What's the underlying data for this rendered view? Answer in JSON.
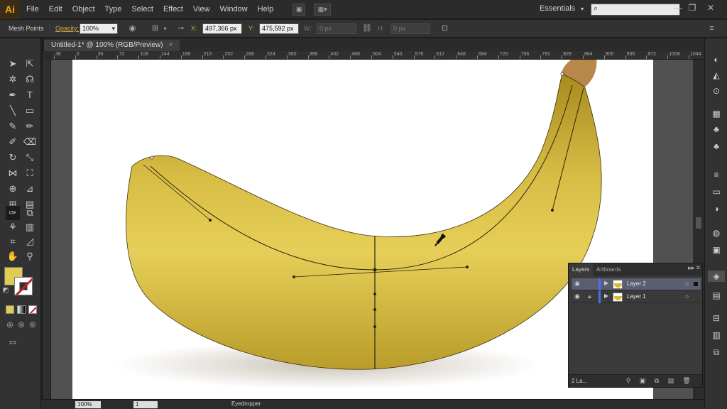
{
  "app": {
    "logo": "Ai"
  },
  "menu": [
    "File",
    "Edit",
    "Object",
    "Type",
    "Select",
    "Effect",
    "View",
    "Window",
    "Help"
  ],
  "workspace": {
    "label": "Essentials",
    "caret": "▾"
  },
  "search": {
    "placeholder": ""
  },
  "window_controls": {
    "minimize": "—",
    "restore": "❐",
    "close": "✕"
  },
  "control_bar": {
    "tool_name": "Mesh Points",
    "opacity_label": "Opacity:",
    "opacity_value": "100%",
    "x_label": "X:",
    "x_value": "497,366 px",
    "y_label": "Y:",
    "y_value": "475,592 px",
    "w_label": "W:",
    "w_value": "0 px",
    "h_label": "H:",
    "h_value": "0 px"
  },
  "document_tab": {
    "title": "Untitled-1* @ 100% (RGB/Preview)",
    "close": "×"
  },
  "ruler_ticks": [
    "36",
    "0",
    "36",
    "72",
    "108",
    "144",
    "180",
    "216",
    "252",
    "288",
    "324",
    "360",
    "396",
    "432",
    "468",
    "504",
    "540",
    "576",
    "612",
    "648",
    "684",
    "720",
    "756",
    "792",
    "828",
    "864",
    "900",
    "936",
    "972",
    "1008",
    "1044"
  ],
  "status_bar": {
    "zoom": "100%",
    "artboard": "1",
    "current_tool": "Eyedropper"
  },
  "layers_panel": {
    "tabs": [
      "Layers",
      "Artboards"
    ],
    "menu_icon": "▸▸ ≡",
    "layers": [
      {
        "name": "Layer 2",
        "selected": true,
        "locked": false
      },
      {
        "name": "Layer 1",
        "selected": false,
        "locked": true
      }
    ],
    "count_label": "2 La..."
  },
  "colors": {
    "fill": "#e2cb55",
    "stroke": "none",
    "layer_color": "#4f6df5"
  }
}
